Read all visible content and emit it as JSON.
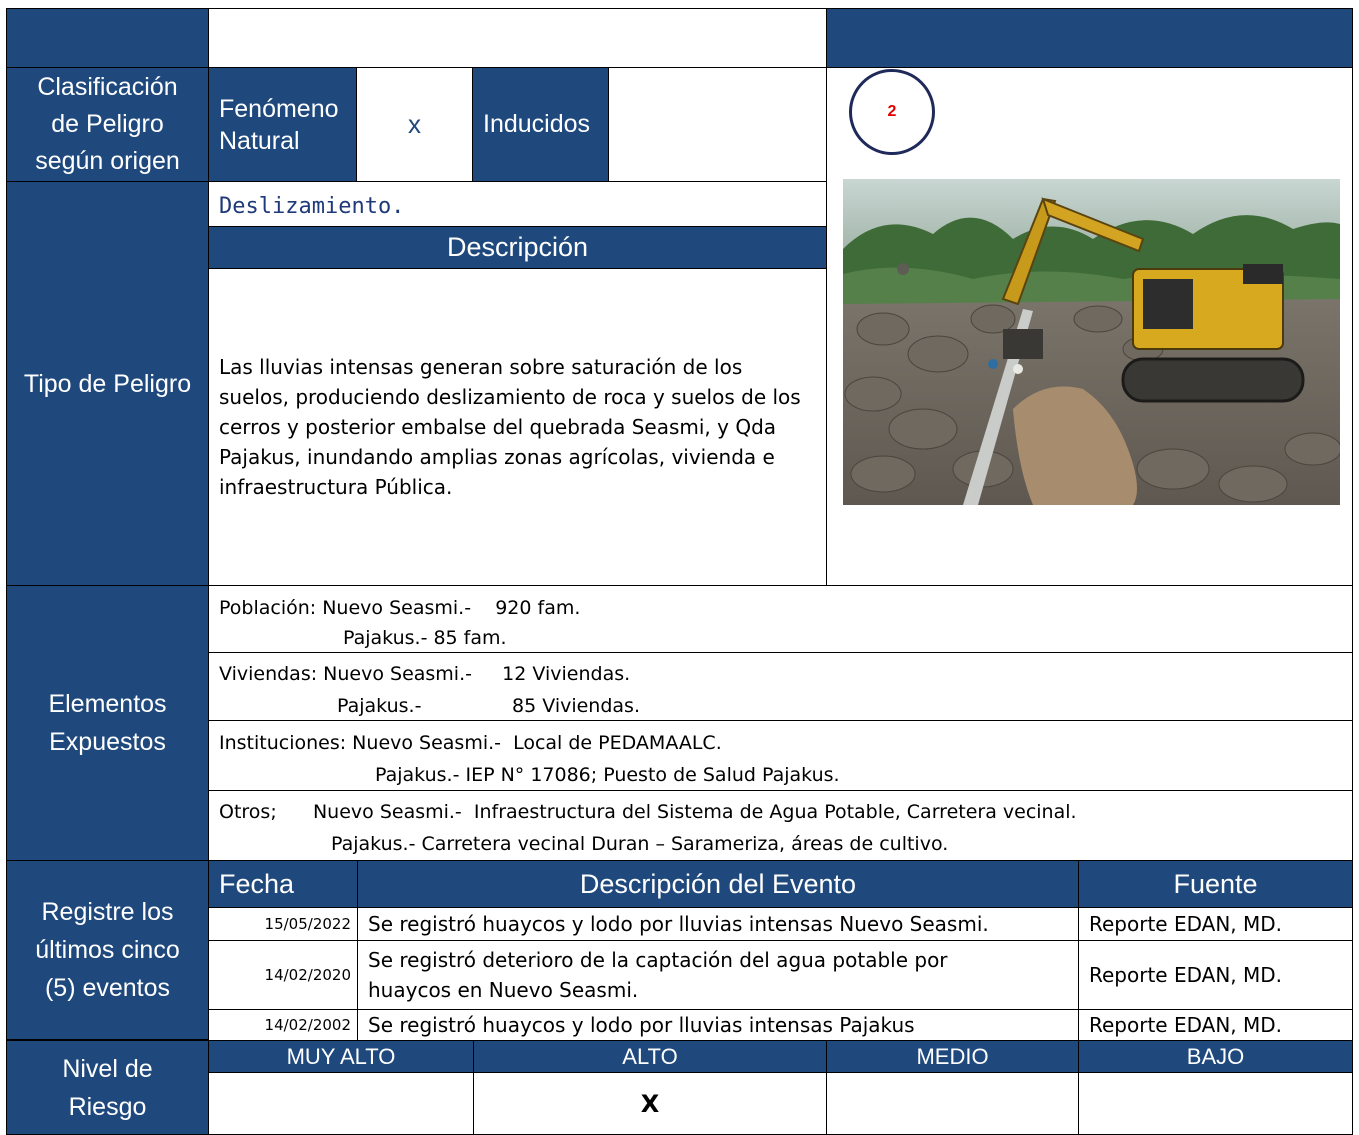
{
  "classification": {
    "label": "Clasificación de Peligro según origen",
    "natural_label": "Fenómeno Natural",
    "natural_mark": "x",
    "induced_label": "Inducidos",
    "induced_mark": ""
  },
  "photo": {
    "number": "2"
  },
  "hazard": {
    "label": "Tipo de Peligro",
    "type": "Deslizamiento.",
    "description_header": "Descripción",
    "description": "Las lluvias intensas generan sobre saturación de los suelos, produciendo deslizamiento de roca y suelos de los cerros y posterior embalse del quebrada Seasmi, y Qda Pajakus, inundando amplias zonas agrícolas, vivienda e infraestructura Pública."
  },
  "exposed": {
    "label": "Elementos Expuestos",
    "population": [
      "Población: Nuevo Seasmi.-    920 fam.",
      "Pajakus.- 85 fam."
    ],
    "housing": [
      "Viviendas: Nuevo Seasmi.-     12 Viviendas.",
      "Pajakus.-               85 Viviendas."
    ],
    "institutions": [
      "Instituciones: Nuevo Seasmi.-  Local de PEDAMAALC.",
      "Pajakus.- IEP N° 17086; Puesto de Salud Pajakus."
    ],
    "others": [
      "Otros;      Nuevo Seasmi.-  Infraestructura del Sistema de Agua Potable, Carretera vecinal.",
      "Pajakus.- Carretera vecinal Duran – Sarameriza, áreas de cultivo."
    ]
  },
  "events": {
    "label": "Registre los últimos cinco (5) eventos",
    "headers": {
      "date": "Fecha",
      "description": "Descripción del Evento",
      "source": "Fuente"
    },
    "rows": [
      {
        "date": "15/05/2022",
        "description": "Se registró huaycos y lodo por lluvias intensas Nuevo Seasmi.",
        "source": "Reporte EDAN, MD."
      },
      {
        "date": "14/02/2020",
        "description": "Se registró deterioro de la captación del agua potable por huaycos en Nuevo Seasmi.",
        "source": "Reporte EDAN, MD."
      },
      {
        "date": "14/02/2002",
        "description": "Se registró huaycos y lodo por lluvias intensas Pajakus",
        "source": "Reporte EDAN, MD."
      }
    ]
  },
  "risk": {
    "label": "Nivel de Riesgo",
    "levels": [
      "MUY ALTO",
      "ALTO",
      "MEDIO",
      "BAJO"
    ],
    "marks": [
      "",
      "X",
      "",
      ""
    ]
  },
  "colors": {
    "header_blue": "#1f497d",
    "badge_red": "#e00000",
    "hazard_text": "#1f3a7a"
  }
}
